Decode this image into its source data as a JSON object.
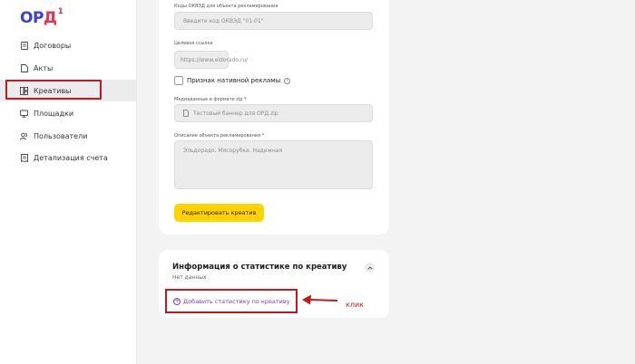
{
  "logo": {
    "text_main": "ОР",
    "text_d": "Д",
    "sup": "1"
  },
  "sidebar": {
    "items": [
      {
        "label": "Договоры",
        "icon": "document-icon"
      },
      {
        "label": "Акты",
        "icon": "file-icon"
      },
      {
        "label": "Креативы",
        "icon": "creatives-icon",
        "active": true
      },
      {
        "label": "Площадки",
        "icon": "monitor-icon"
      },
      {
        "label": "Пользователи",
        "icon": "users-icon"
      },
      {
        "label": "Детализация счета",
        "icon": "receipt-icon"
      }
    ]
  },
  "form": {
    "okved_label": "Коды ОКВЭД для объекта рекламирования",
    "okved_placeholder": "Введите код ОКВЭД \"01.01\"",
    "target_label": "Целевая ссылка",
    "target_value": "https://www.eldorado.ru/",
    "native_ad_label": "Признак нативной рекламы",
    "media_label": "Медиаданные в формате zip *",
    "media_file": "Тестовый баннер для ОРД.zip",
    "description_label": "Описание объекта рекламирования *",
    "description_value": "Эльдорадо. Мясорубка. Надежная",
    "edit_button": "Редактировать креатив"
  },
  "stats": {
    "title": "Информация о статистике по креативу",
    "subtitle": "Нет данных",
    "add_link": "Добавить статистику по креативу"
  },
  "annotation": {
    "click_label": "клик"
  },
  "colors": {
    "accent_yellow": "#ffd200",
    "highlight_red": "#c2181f",
    "link_purple": "#7a3ad6",
    "logo_blue": "#3a3fd8"
  }
}
